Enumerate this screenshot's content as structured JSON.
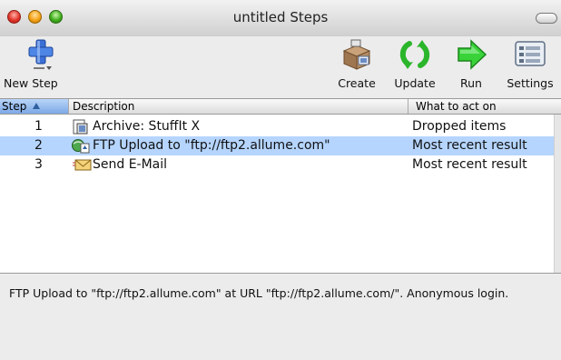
{
  "window": {
    "title": "untitled Steps"
  },
  "toolbar": {
    "new_step": "New Step",
    "create": "Create",
    "update": "Update",
    "run": "Run",
    "settings": "Settings"
  },
  "table": {
    "columns": [
      "Step",
      "Description",
      "What to act on"
    ],
    "sorted_column": "Step",
    "rows": [
      {
        "step": "1",
        "description": "Archive: StuffIt X",
        "target": "Dropped items",
        "icon": "archive-icon",
        "selected": false
      },
      {
        "step": "2",
        "description": "FTP Upload to \"ftp://ftp2.allume.com\"",
        "target": "Most recent result",
        "icon": "ftp-upload-icon",
        "selected": true
      },
      {
        "step": "3",
        "description": "Send E-Mail",
        "target": "Most recent result",
        "icon": "email-icon",
        "selected": false
      }
    ]
  },
  "details": {
    "text": "FTP Upload to \"ftp://ftp2.allume.com\" at URL \"ftp://ftp2.allume.com/\". Anonymous login."
  },
  "colors": {
    "selection": "#b5d5ff",
    "sort_header": "#7ca8e6",
    "accent_green": "#2ec82e"
  }
}
